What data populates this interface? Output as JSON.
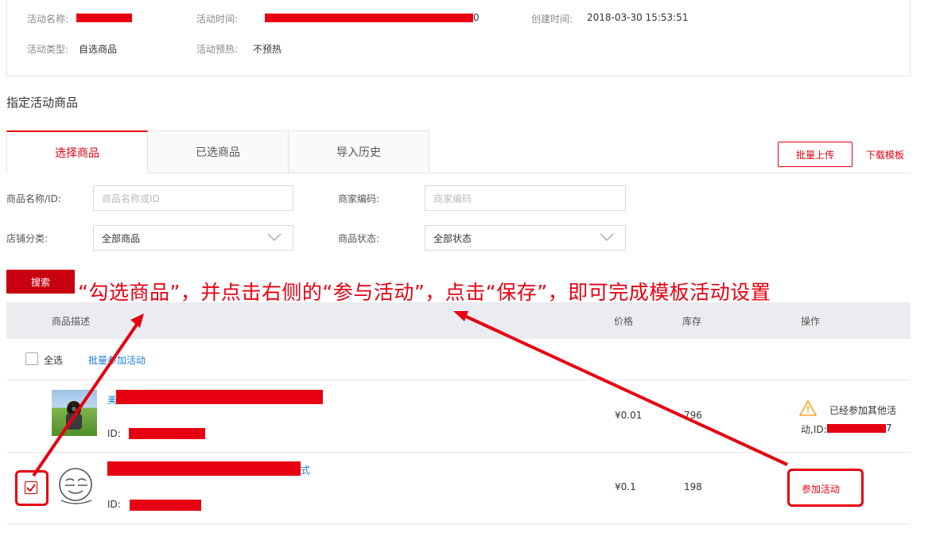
{
  "info": {
    "name_label": "活动名称:",
    "time_label": "活动时间:",
    "time_value_tail": "0",
    "created_label": "创建时间:",
    "created_value": "2018-03-30 15:53:51",
    "type_label": "活动类型:",
    "type_value": "自选商品",
    "preheat_label": "活动预热:",
    "preheat_value": "不预热"
  },
  "section_title": "指定活动商品",
  "tabs": [
    {
      "label": "选择商品",
      "active": true
    },
    {
      "label": "已选商品",
      "active": false
    },
    {
      "label": "导入历史",
      "active": false
    }
  ],
  "actions": {
    "batch_upload": "批量上传",
    "download_template": "下载模板"
  },
  "filters": {
    "name_label": "商品名称/ID:",
    "name_placeholder": "商品名称或ID",
    "code_label": "商家编码:",
    "code_placeholder": "商家编码",
    "category_label": "店铺分类:",
    "category_value": "全部商品",
    "status_label": "商品状态:",
    "status_value": "全部状态",
    "search_button": "搜索"
  },
  "annotation": "“勾选商品”，并点击右侧的“参与活动”，点击“保存”，即可完成模板活动设置",
  "table": {
    "headers": {
      "desc": "商品描述",
      "price": "价格",
      "stock": "库存",
      "ops": "操作"
    },
    "select_all": "全选",
    "batch_join": "批量参加活动",
    "rows": [
      {
        "title_prefix": "美",
        "id_label": "ID:",
        "price": "¥0.01",
        "stock": "796",
        "status_line1": "已经参加其他活",
        "status_line2_prefix": "动,ID:",
        "status_line2_tail": "7",
        "checked": false
      },
      {
        "title_suffix": "式",
        "id_label": "ID:",
        "price": "¥0.1",
        "stock": "198",
        "action": "参加活动",
        "checked": true
      }
    ]
  },
  "colors": {
    "accent": "#e60012",
    "link": "#1a7fd1",
    "header_bg": "#ebecf0"
  }
}
